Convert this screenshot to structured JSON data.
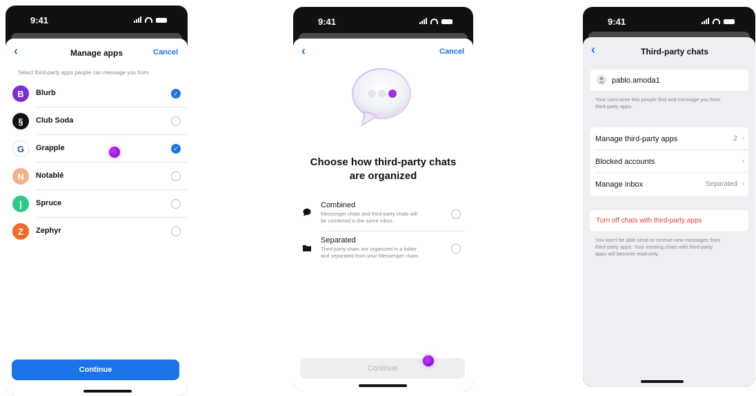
{
  "status": {
    "time": "9:41"
  },
  "screen1": {
    "back_icon": "chevron-left-icon",
    "title": "Manage apps",
    "cancel": "Cancel",
    "subtitle": "Select third-party apps people can message you from.",
    "apps": [
      {
        "name": "Blurb",
        "letter": "B",
        "color": "#7b2fd1",
        "checked": true
      },
      {
        "name": "Club Soda",
        "letter": "§",
        "color": "#111111",
        "checked": false
      },
      {
        "name": "Grapple",
        "letter": "G",
        "color": "#ffffff",
        "checked": true
      },
      {
        "name": "Notablé",
        "letter": "N",
        "color": "#f0b38c",
        "checked": false
      },
      {
        "name": "Spruce",
        "letter": "|",
        "color": "#2ec98a",
        "checked": false
      },
      {
        "name": "Zephyr",
        "letter": "Z",
        "color": "#ef6a2a",
        "checked": false
      }
    ],
    "continue": "Continue"
  },
  "screen2": {
    "back_icon": "chevron-left-icon",
    "cancel": "Cancel",
    "heading_line1": "Choose how third-party chats",
    "heading_line2": "are organized",
    "options": [
      {
        "title": "Combined",
        "desc1": "Messenger chats and third-party chats will",
        "desc2": "be combined in the same inbox.",
        "icon": "chat-bubble-icon"
      },
      {
        "title": "Separated",
        "desc1": "Third-party chats are organized in a folder",
        "desc2": "and separated from your Messenger chats.",
        "icon": "folder-icon"
      }
    ],
    "continue": "Continue"
  },
  "screen3": {
    "back_icon": "chevron-left-icon",
    "title": "Third-party chats",
    "username": "pablo.amoda1",
    "username_note1": "Your username lets people find and message you from",
    "username_note2": "third-party apps.",
    "rows": [
      {
        "label": "Manage third-party apps",
        "value": "2"
      },
      {
        "label": "Blocked accounts",
        "value": ""
      },
      {
        "label": "Manage inbox",
        "value": "Separated"
      }
    ],
    "turn_off": "Turn off chats with third-party apps",
    "turn_off_note1": "You won't be able send or receive new messages from",
    "turn_off_note2": "third-party apps. Your existing chats with third-party",
    "turn_off_note3": "apps will become read-only."
  },
  "colors": {
    "accent": "#1a73e8",
    "danger": "#e53935"
  }
}
